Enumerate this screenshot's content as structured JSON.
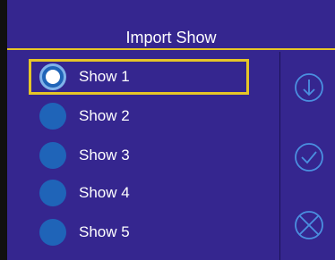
{
  "header": {
    "title": "Import Show"
  },
  "shows": [
    {
      "label": "Show 1",
      "selected": true
    },
    {
      "label": "Show 2",
      "selected": false
    },
    {
      "label": "Show 3",
      "selected": false
    },
    {
      "label": "Show 4",
      "selected": false
    },
    {
      "label": "Show 5",
      "selected": false
    }
  ],
  "side_actions": [
    {
      "icon": "download-icon"
    },
    {
      "icon": "check-icon"
    },
    {
      "icon": "cancel-icon"
    }
  ],
  "colors": {
    "background": "#35268f",
    "accent": "#e6c528",
    "radio": "#1f64b8",
    "text": "#ffffff"
  }
}
